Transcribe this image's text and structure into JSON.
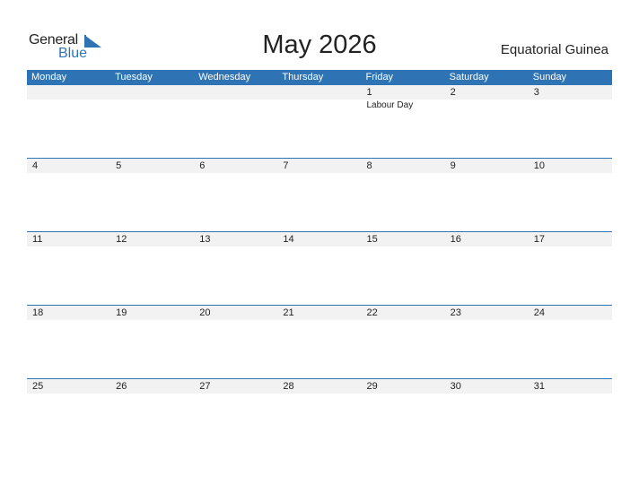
{
  "logo": {
    "word1": "General",
    "word2": "Blue"
  },
  "title": "May 2026",
  "country": "Equatorial Guinea",
  "colors": {
    "accent": "#2e74b5",
    "date_row_bg": "#f2f2f2"
  },
  "weekdays": [
    "Monday",
    "Tuesday",
    "Wednesday",
    "Thursday",
    "Friday",
    "Saturday",
    "Sunday"
  ],
  "weeks": [
    {
      "days": [
        "",
        "",
        "",
        "",
        "1",
        "2",
        "3"
      ],
      "events": [
        "",
        "",
        "",
        "",
        "Labour Day",
        "",
        ""
      ]
    },
    {
      "days": [
        "4",
        "5",
        "6",
        "7",
        "8",
        "9",
        "10"
      ],
      "events": [
        "",
        "",
        "",
        "",
        "",
        "",
        ""
      ]
    },
    {
      "days": [
        "11",
        "12",
        "13",
        "14",
        "15",
        "16",
        "17"
      ],
      "events": [
        "",
        "",
        "",
        "",
        "",
        "",
        ""
      ]
    },
    {
      "days": [
        "18",
        "19",
        "20",
        "21",
        "22",
        "23",
        "24"
      ],
      "events": [
        "",
        "",
        "",
        "",
        "",
        "",
        ""
      ]
    },
    {
      "days": [
        "25",
        "26",
        "27",
        "28",
        "29",
        "30",
        "31"
      ],
      "events": [
        "",
        "",
        "",
        "",
        "",
        "",
        ""
      ]
    }
  ]
}
